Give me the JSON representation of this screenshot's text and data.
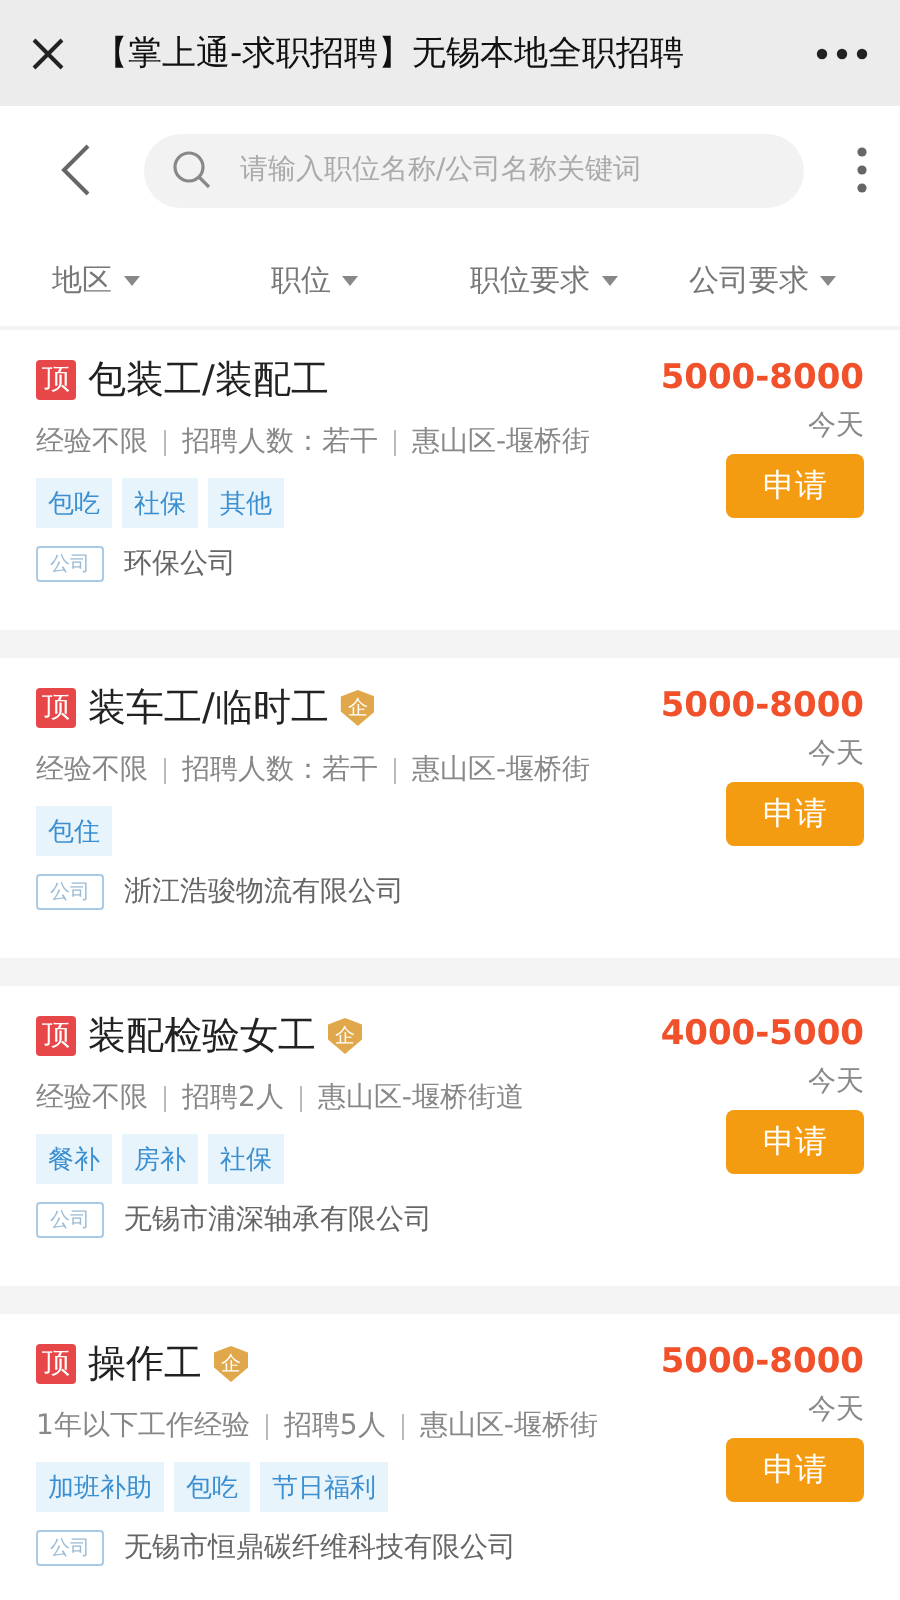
{
  "top_bar": {
    "title": "【掌上通-求职招聘】无锡本地全职招聘"
  },
  "search": {
    "placeholder": "请输入职位名称/公司名称关键词"
  },
  "filters": [
    {
      "label": "地区"
    },
    {
      "label": "职位"
    },
    {
      "label": "职位要求"
    },
    {
      "label": "公司要求"
    }
  ],
  "jobs": [
    {
      "top_mark": "顶",
      "title": "包装工/装配工",
      "salary": "5000-8000",
      "date": "今天",
      "meta": [
        "经验不限",
        "招聘人数：若干",
        "惠山区-堰桥街"
      ],
      "tags": [
        "包吃",
        "社保",
        "其他"
      ],
      "company_label": "公司",
      "company": "环保公司",
      "apply": "申请"
    },
    {
      "top_mark": "顶",
      "title": "装车工/临时工",
      "verified_mark": "企",
      "salary": "5000-8000",
      "date": "今天",
      "meta": [
        "经验不限",
        "招聘人数：若干",
        "惠山区-堰桥街"
      ],
      "tags": [
        "包住"
      ],
      "company_label": "公司",
      "company": "浙江浩骏物流有限公司",
      "apply": "申请"
    },
    {
      "top_mark": "顶",
      "title": "装配检验女工",
      "verified_mark": "企",
      "salary": "4000-5000",
      "date": "今天",
      "meta": [
        "经验不限",
        "招聘2人",
        "惠山区-堰桥街道"
      ],
      "tags": [
        "餐补",
        "房补",
        "社保"
      ],
      "company_label": "公司",
      "company": "无锡市浦深轴承有限公司",
      "apply": "申请"
    },
    {
      "top_mark": "顶",
      "title": "操作工",
      "verified_mark": "企",
      "salary": "5000-8000",
      "date": "今天",
      "meta": [
        "1年以下工作经验",
        "招聘5人",
        "惠山区-堰桥街"
      ],
      "tags": [
        "加班补助",
        "包吃",
        "节日福利"
      ],
      "company_label": "公司",
      "company": "无锡市恒鼎碳纤维科技有限公司",
      "apply": "申请"
    }
  ]
}
